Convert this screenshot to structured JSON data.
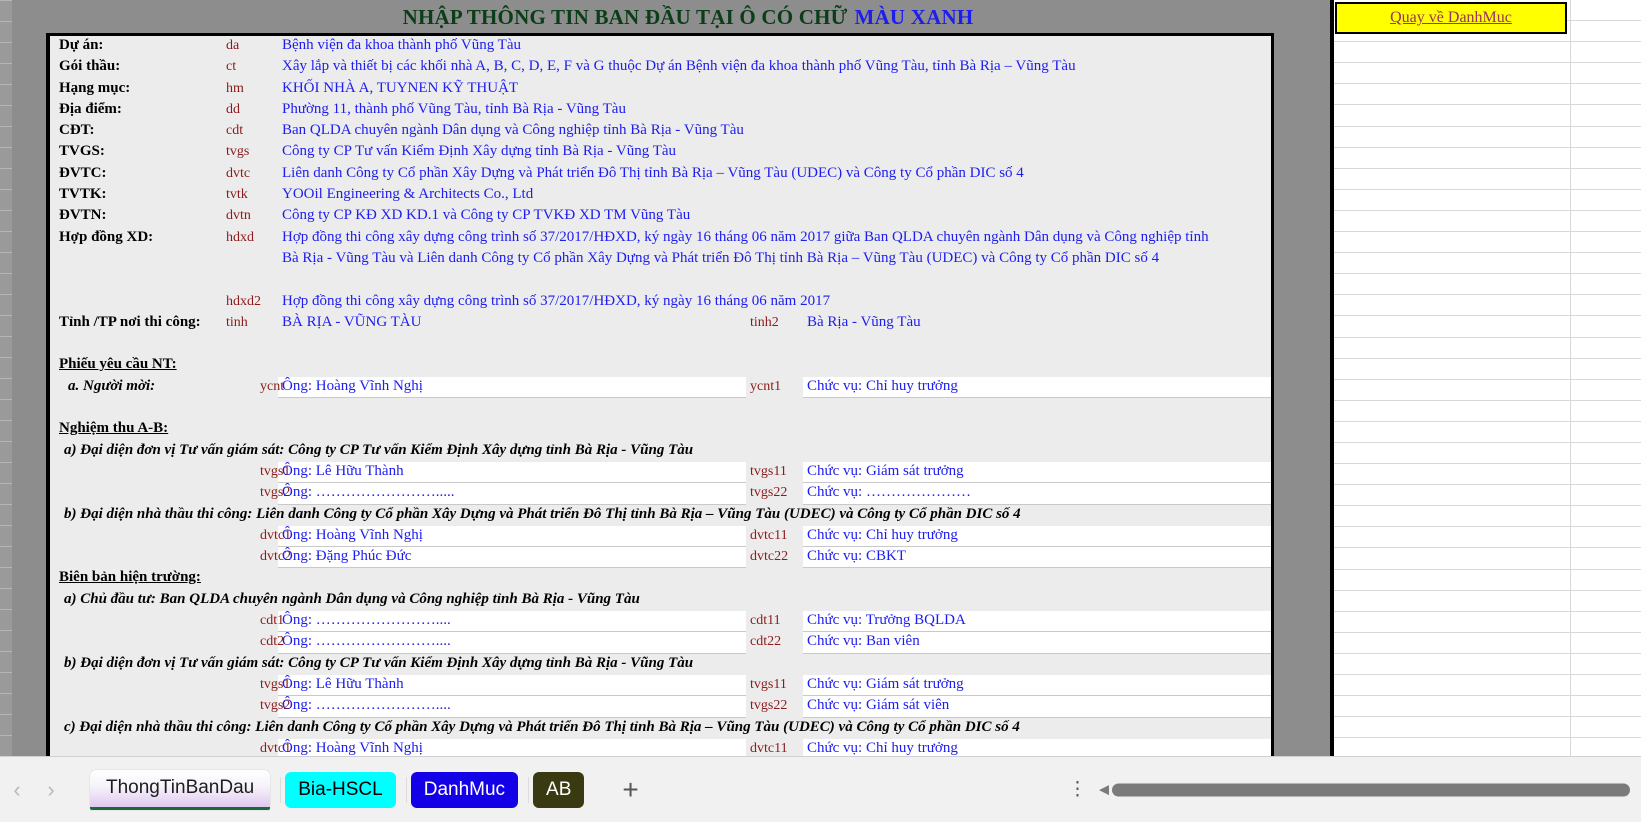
{
  "title": {
    "main": "NHẬP THÔNG TIN BAN ĐẦU TẠI Ô CÓ CHỮ",
    "highlight": "MÀU XANH"
  },
  "top_button": {
    "label": "Quay về DanhMuc"
  },
  "colors": {
    "title_green": "#0b3d18",
    "value_blue": "#1d1df0",
    "code_red": "#8b1a1a",
    "button_yellow": "#ffff00",
    "link_purple": "#9a3264",
    "tab_cyan": "#00ffff",
    "tab_blue": "#1400e6",
    "tab_olive": "#3a3a12",
    "sheet_gray": "#8d8d8d"
  },
  "rows": [
    {
      "type": "field",
      "label": "Dự án:",
      "code": "da",
      "value": "Bệnh viện đa khoa thành phố Vũng Tàu"
    },
    {
      "type": "field",
      "label": "Gói thầu:",
      "code": "ct",
      "value": "Xây lắp và thiết bị các khối nhà A, B, C, D, E, F và G thuộc Dự án Bệnh viện đa khoa thành phố Vũng Tàu, tỉnh Bà Rịa – Vũng Tàu"
    },
    {
      "type": "field",
      "label": "Hạng mục:",
      "code": "hm",
      "value": "KHỐI NHÀ A, TUYNEN KỸ THUẬT"
    },
    {
      "type": "field",
      "label": "Địa điểm:",
      "code": "dd",
      "value": "Phường 11, thành phố Vũng Tàu, tỉnh Bà Rịa - Vũng Tàu"
    },
    {
      "type": "field",
      "label": "CĐT:",
      "code": "cdt",
      "value": "Ban QLDA chuyên ngành Dân dụng và Công nghiệp tỉnh Bà Rịa - Vũng Tàu"
    },
    {
      "type": "field",
      "label": "TVGS:",
      "code": "tvgs",
      "value": "Công ty CP Tư vấn Kiểm Định Xây dựng tỉnh Bà Rịa - Vũng Tàu"
    },
    {
      "type": "field",
      "label": "ĐVTC:",
      "code": "dvtc",
      "value": "Liên danh Công ty Cổ phần Xây Dựng và Phát triển Đô Thị tỉnh Bà Rịa – Vũng Tàu (UDEC) và Công ty Cổ phần DIC số 4"
    },
    {
      "type": "field",
      "label": "TVTK:",
      "code": "tvtk",
      "value": "YOOil Engineering & Architects Co., Ltd"
    },
    {
      "type": "field",
      "label": "ĐVTN:",
      "code": "dvtn",
      "value": "Công ty CP KĐ XD KD.1 và Công ty CP TVKĐ XD TM Vũng Tàu"
    },
    {
      "type": "field",
      "label": "Hợp đồng XD:",
      "code": "hdxd",
      "value": "Hợp đồng thi công xây dựng công trình số 37/2017/HĐXD, ký ngày 16 tháng 06 năm 2017 giữa Ban QLDA chuyên ngành Dân dụng và Công nghiệp tỉnh"
    },
    {
      "type": "cont",
      "value": "Bà Rịa - Vũng Tàu và Liên danh Công ty Cổ phần Xây Dựng và Phát triển Đô Thị tỉnh Bà Rịa – Vũng Tàu (UDEC) và Công ty Cổ phần DIC số 4"
    },
    {
      "type": "blank"
    },
    {
      "type": "field",
      "label": "",
      "code": "hdxd2",
      "value": "Hợp đồng thi công xây dựng công trình số 37/2017/HĐXD, ký ngày 16 tháng 06 năm 2017"
    },
    {
      "type": "pair",
      "label": "Tỉnh /TP nơi thi công:",
      "code": "tinh",
      "value": "BÀ RỊA - VŨNG TÀU",
      "code2": "tinh2",
      "value2": "Bà Rịa - Vũng Tàu"
    },
    {
      "type": "blank"
    },
    {
      "type": "heading_u",
      "label": "Phiếu yêu cầu NT:"
    },
    {
      "type": "inputpair",
      "label": "a. Người mời:",
      "label_style": "ital",
      "code": "ycnt",
      "value": "Ông: Hoàng Vĩnh Nghị",
      "code2": "ycnt1",
      "value2": "Chức vụ: Chỉ huy trưởng"
    },
    {
      "type": "blank"
    },
    {
      "type": "heading_u",
      "label": "Nghiệm thu A-B:"
    },
    {
      "type": "subhead",
      "label": "a) Đại diện đơn vị Tư vấn giám sát: Công ty CP Tư vấn Kiểm Định Xây dựng tỉnh Bà Rịa - Vũng Tàu"
    },
    {
      "type": "inputpair",
      "code": "tvgs1",
      "value": "Ông: Lê Hữu Thành",
      "code2": "tvgs11",
      "value2": "Chức vụ: Giám sát trưởng"
    },
    {
      "type": "inputpair",
      "code": "tvgs2",
      "value": "Ông: …………………….....",
      "code2": "tvgs22",
      "value2": "Chức vụ: …………………"
    },
    {
      "type": "subhead",
      "label": "b) Đại diện nhà thầu thi công: Liên danh Công ty Cổ phần Xây Dựng và Phát triển Đô Thị tỉnh Bà Rịa – Vũng Tàu (UDEC) và Công ty Cổ phần DIC số 4"
    },
    {
      "type": "inputpair",
      "code": "dvtc1",
      "value": "Ông: Hoàng Vĩnh Nghị",
      "code2": "dvtc11",
      "value2": "Chức vụ: Chỉ huy trưởng"
    },
    {
      "type": "inputpair",
      "code": "dvtc2",
      "value": "Ông: Đặng Phúc Đức",
      "code2": "dvtc22",
      "value2": "Chức vụ: CBKT"
    },
    {
      "type": "heading_u",
      "label": "Biên bản hiện trường:"
    },
    {
      "type": "subhead",
      "label": "a) Chủ đầu tư: Ban QLDA chuyên ngành Dân dụng và Công nghiệp tỉnh Bà Rịa - Vũng Tàu"
    },
    {
      "type": "inputpair",
      "code": "cdt1",
      "value": "Ông: ……………………....",
      "code2": "cdt11",
      "value2": "Chức vụ: Trưởng BQLDA"
    },
    {
      "type": "inputpair",
      "code": "cdt2",
      "value": "Ông: ……………………....",
      "code2": "cdt22",
      "value2": "Chức vụ: Ban viên"
    },
    {
      "type": "subhead",
      "label": "b) Đại diện đơn vị Tư vấn giám sát: Công ty CP Tư vấn Kiểm Định Xây dựng tỉnh Bà Rịa - Vũng Tàu"
    },
    {
      "type": "inputpair",
      "code": "tvgs1",
      "value": "Ông: Lê Hữu Thành",
      "code2": "tvgs11",
      "value2": "Chức vụ: Giám sát trưởng"
    },
    {
      "type": "inputpair",
      "code": "tvgs2",
      "value": "Ông: ……………………....",
      "code2": "tvgs22",
      "value2": "Chức vụ: Giám sát viên"
    },
    {
      "type": "subhead",
      "label": "c) Đại diện nhà thầu thi công: Liên danh Công ty Cổ phần Xây Dựng và Phát triển Đô Thị tỉnh Bà Rịa – Vũng Tàu (UDEC) và Công ty Cổ phần DIC số 4"
    },
    {
      "type": "inputpair",
      "code": "dvtc1",
      "value": "Ông: Hoàng Vĩnh Nghị",
      "code2": "dvtc11",
      "value2": "Chức vụ: Chỉ huy trưởng"
    }
  ],
  "tabbar": {
    "prev_icon": "‹",
    "next_icon": "›",
    "tabs": [
      {
        "label": "ThongTinBanDau",
        "style": "active"
      },
      {
        "label": "Bia-HSCL",
        "style": "cyan"
      },
      {
        "label": "DanhMuc",
        "style": "blue"
      },
      {
        "label": "AB",
        "style": "olive"
      }
    ],
    "add_label": "+",
    "kebab_label": "⋮",
    "scroll_left_icon": "◀"
  }
}
